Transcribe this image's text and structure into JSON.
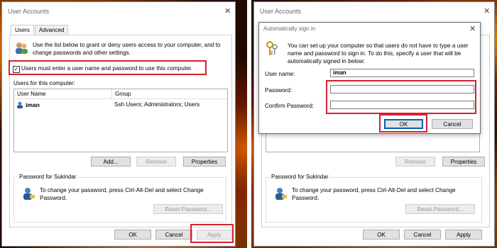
{
  "left": {
    "title": "User Accounts",
    "tabs": [
      "Users",
      "Advanced"
    ],
    "intro": "Use the list below to grant or deny users access to your computer, and to change passwords and other settings.",
    "checkbox_label": "Users must enter a user name and password to use this computer.",
    "users_label": "Users for this computer:",
    "columns": [
      "User Name",
      "Group"
    ],
    "row": {
      "name": "iman",
      "group": "Ssh Users; Administrators; Users"
    },
    "buttons": {
      "add": "Add...",
      "remove": "Remove",
      "properties": "Properties"
    },
    "password_group": "Password for Sukindar",
    "password_text": "To change your password, press Ctrl-Alt-Del and select Change Password.",
    "reset": "Reset Password...",
    "bottom": {
      "ok": "OK",
      "cancel": "Cancel",
      "apply": "Apply"
    }
  },
  "right": {
    "title": "User Accounts",
    "dialog_title": "Automatically sign in",
    "dialog_text": "You can set up your computer so that users do not have to type a user name and password to sign in. To do this, specify a user that will be automatically signed in below:",
    "username_label": "User name:",
    "username_value": "iman",
    "password_label": "Password:",
    "confirm_label": "Confirm Password:",
    "ok": "OK",
    "cancel": "Cancel",
    "buttons": {
      "remove": "Remove",
      "properties": "Properties"
    },
    "password_group": "Password for Sukindar",
    "password_text": "To change your password, press Ctrl-Alt-Del and select Change Password.",
    "reset": "Reset Password...",
    "bottom": {
      "ok": "OK",
      "cancel": "Cancel",
      "apply": "Apply"
    }
  },
  "colors": {
    "highlight": "#d62030",
    "accent": "#0063b1"
  }
}
